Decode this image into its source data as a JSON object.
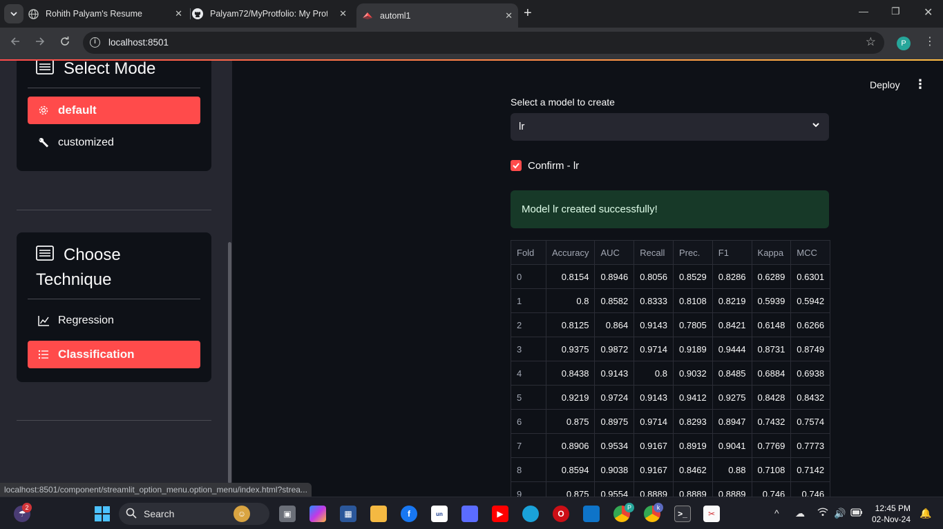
{
  "browser": {
    "tabs": [
      {
        "title": "Rohith Palyam's Resume",
        "active": false
      },
      {
        "title": "Palyam72/MyProtfolio: My Prot",
        "active": false
      },
      {
        "title": "automl1",
        "active": true
      }
    ],
    "url": "localhost:8501",
    "profile_initial": "P",
    "status_url": "localhost:8501/component/streamlit_option_menu.option_menu/index.html?strea..."
  },
  "sidebar": {
    "mode_card": {
      "title": "Select Mode",
      "options": [
        {
          "label": "default",
          "icon": "gear-icon",
          "selected": true
        },
        {
          "label": "customized",
          "icon": "wrench-icon",
          "selected": false
        }
      ]
    },
    "technique_card": {
      "title_line1": "Choose",
      "title_line2": "Technique",
      "options": [
        {
          "label": "Regression",
          "icon": "line-chart-icon",
          "selected": false
        },
        {
          "label": "Classification",
          "icon": "list-icon",
          "selected": true
        }
      ]
    }
  },
  "main": {
    "deploy_label": "Deploy",
    "select_label": "Select a model to create",
    "select_value": "lr",
    "confirm_label": "Confirm - lr",
    "confirm_checked": true,
    "success_message": "Model lr created successfully!",
    "table": {
      "columns": [
        "Fold",
        "Accuracy",
        "AUC",
        "Recall",
        "Prec.",
        "F1",
        "Kappa",
        "MCC"
      ],
      "rows": [
        [
          "0",
          "0.8154",
          "0.8946",
          "0.8056",
          "0.8529",
          "0.8286",
          "0.6289",
          "0.6301"
        ],
        [
          "1",
          "0.8",
          "0.8582",
          "0.8333",
          "0.8108",
          "0.8219",
          "0.5939",
          "0.5942"
        ],
        [
          "2",
          "0.8125",
          "0.864",
          "0.9143",
          "0.7805",
          "0.8421",
          "0.6148",
          "0.6266"
        ],
        [
          "3",
          "0.9375",
          "0.9872",
          "0.9714",
          "0.9189",
          "0.9444",
          "0.8731",
          "0.8749"
        ],
        [
          "4",
          "0.8438",
          "0.9143",
          "0.8",
          "0.9032",
          "0.8485",
          "0.6884",
          "0.6938"
        ],
        [
          "5",
          "0.9219",
          "0.9724",
          "0.9143",
          "0.9412",
          "0.9275",
          "0.8428",
          "0.8432"
        ],
        [
          "6",
          "0.875",
          "0.8975",
          "0.9714",
          "0.8293",
          "0.8947",
          "0.7432",
          "0.7574"
        ],
        [
          "7",
          "0.8906",
          "0.9534",
          "0.9167",
          "0.8919",
          "0.9041",
          "0.7769",
          "0.7773"
        ],
        [
          "8",
          "0.8594",
          "0.9038",
          "0.9167",
          "0.8462",
          "0.88",
          "0.7108",
          "0.7142"
        ],
        [
          "9",
          "0.875",
          "0.9554",
          "0.8889",
          "0.8889",
          "0.8889",
          "0.746",
          "0.746"
        ]
      ]
    }
  },
  "taskbar": {
    "search_label": "Search",
    "time": "12:45 PM",
    "date": "02-Nov-24",
    "widgets_badge": "2",
    "chrome_badge_1": "P",
    "chrome_badge_2": "k"
  }
}
